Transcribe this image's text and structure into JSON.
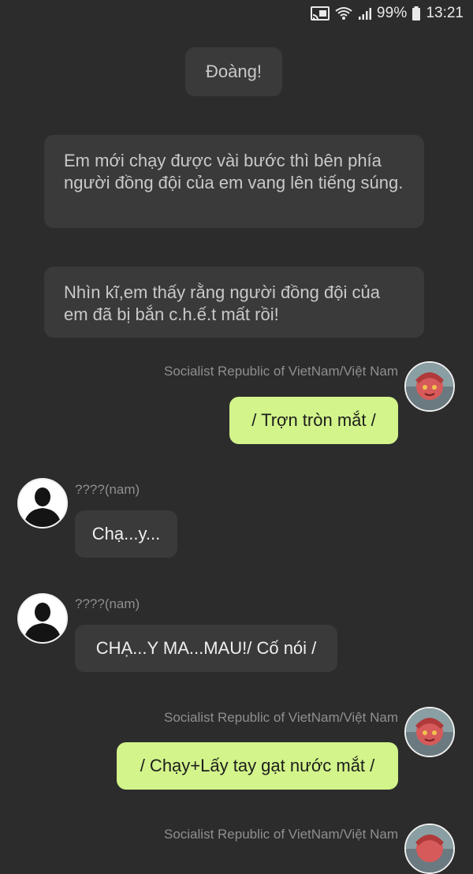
{
  "status_bar": {
    "battery_percent": "99%",
    "time": "13:21",
    "icons": [
      "cast-icon",
      "wifi-icon",
      "signal-icon",
      "battery-icon"
    ]
  },
  "narration": [
    "Đoàng!",
    "Em mới chạy được vài bước thì bên phía người đồng đội của em vang lên tiếng súng.",
    "Nhìn kĩ,em thấy rằng người đồng đội của em đã bị bắn c.h.ế.t mất rồi!"
  ],
  "messages": [
    {
      "sender": "Socialist Republic of VietNam/Việt  Nam",
      "side": "right",
      "text": "/ Trợn tròn mắt /"
    },
    {
      "sender": "????(nam)",
      "side": "left",
      "text": "Chạ...y..."
    },
    {
      "sender": "????(nam)",
      "side": "left",
      "text": "CHẠ...Y MA...MAU!/ Cố nói /"
    },
    {
      "sender": "Socialist Republic of VietNam/Việt  Nam",
      "side": "right",
      "text": "/ Chạy+Lấy tay gạt nước mắt /"
    },
    {
      "sender": "Socialist Republic of VietNam/Việt  Nam",
      "side": "right",
      "text": ""
    }
  ],
  "colors": {
    "background": "#2c2c2c",
    "narration_bubble": "#3a3a3a",
    "my_bubble": "#d2f48a",
    "other_bubble": "#3a3a3a",
    "sender_name": "#8f8f8f"
  }
}
